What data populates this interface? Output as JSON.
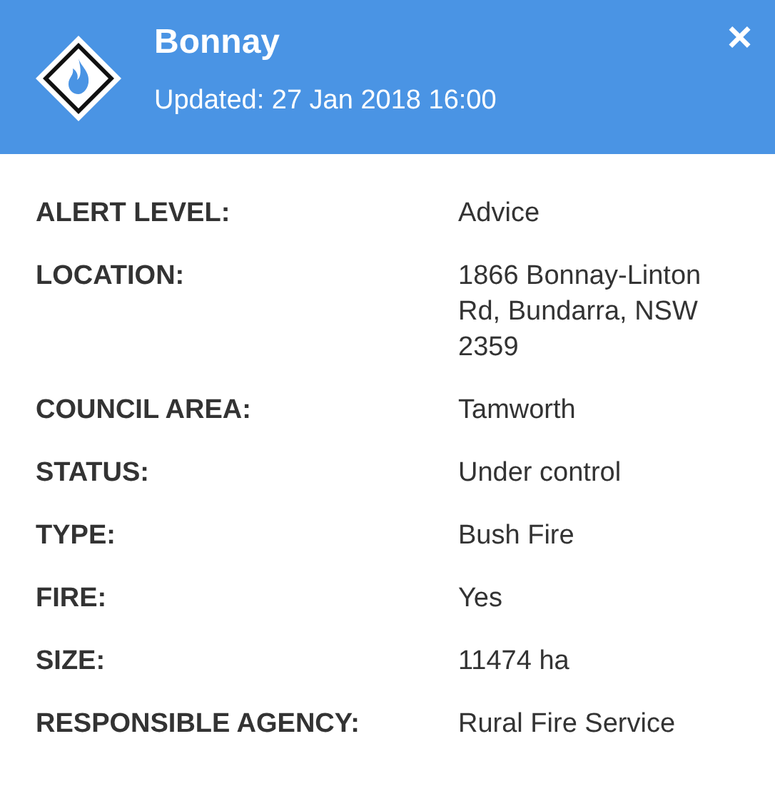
{
  "header": {
    "title": "Bonnay",
    "updated": "Updated: 27 Jan 2018 16:00",
    "close": "×"
  },
  "details": [
    {
      "label": "ALERT LEVEL:",
      "value": "Advice"
    },
    {
      "label": "LOCATION:",
      "value": "1866 Bonnay-Linton Rd, Bundarra, NSW 2359"
    },
    {
      "label": "COUNCIL AREA:",
      "value": "Tamworth"
    },
    {
      "label": "STATUS:",
      "value": "Under control"
    },
    {
      "label": "TYPE:",
      "value": "Bush Fire"
    },
    {
      "label": "FIRE:",
      "value": "Yes"
    },
    {
      "label": "SIZE:",
      "value": "11474 ha"
    },
    {
      "label": "RESPONSIBLE AGENCY:",
      "value": "Rural Fire Service"
    }
  ]
}
